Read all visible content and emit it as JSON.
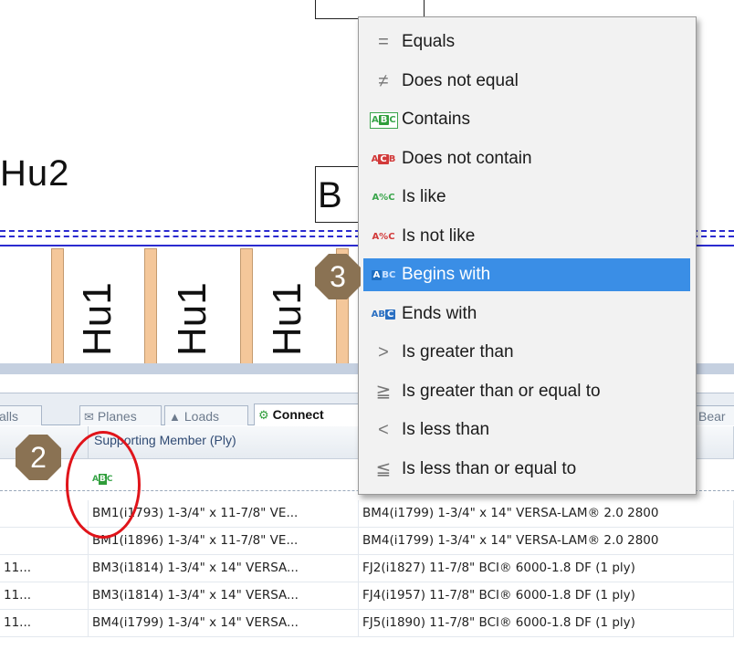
{
  "canvas": {
    "label_left": "Hu2",
    "label_box": "B",
    "joist_labels": [
      "Hu1",
      "Hu1",
      "Hu1"
    ]
  },
  "tabs": [
    {
      "label": "alls",
      "icon": "wall-icon",
      "active": false
    },
    {
      "label": "Planes",
      "icon": "envelope-plane-icon",
      "active": false
    },
    {
      "label": "Loads",
      "icon": "load-icon",
      "active": false
    },
    {
      "label": "Connect",
      "icon": "connection-icon",
      "active": true
    },
    {
      "label": "Bear",
      "icon": "bearing-icon",
      "active": false
    }
  ],
  "grid": {
    "column_header": "Supporting Member (Ply)",
    "filter_icon": "contains-filter-icon",
    "rows": [
      {
        "c0": "",
        "c1": "BM1(i1793) 1-3/4\" x 11-7/8\" VE...",
        "c2": "BM4(i1799) 1-3/4\" x 14\" VERSA-LAM® 2.0 2800"
      },
      {
        "c0": "",
        "c1": "BM1(i1896) 1-3/4\" x 11-7/8\" VE...",
        "c2": "BM4(i1799) 1-3/4\" x 14\" VERSA-LAM® 2.0 2800"
      },
      {
        "c0": "11...",
        "c1": "BM3(i1814) 1-3/4\" x 14\" VERSA...",
        "c2": "FJ2(i1827) 11-7/8\" BCI® 6000-1.8 DF (1 ply)"
      },
      {
        "c0": "11...",
        "c1": "BM3(i1814) 1-3/4\" x 14\" VERSA...",
        "c2": "FJ4(i1957) 11-7/8\" BCI® 6000-1.8 DF (1 ply)"
      },
      {
        "c0": "11...",
        "c1": "BM4(i1799) 1-3/4\" x 14\" VERSA...",
        "c2": "FJ5(i1890) 11-7/8\" BCI® 6000-1.8 DF (1 ply)"
      }
    ]
  },
  "menu": {
    "items": [
      {
        "label": "Equals",
        "icon": "equals-icon",
        "glyph": "="
      },
      {
        "label": "Does not equal",
        "icon": "not-equal-icon",
        "glyph": "≠"
      },
      {
        "label": "Contains",
        "icon": "contains-icon",
        "glyph": "ABC"
      },
      {
        "label": "Does not contain",
        "icon": "does-not-contain-icon",
        "glyph": "ACB"
      },
      {
        "label": "Is like",
        "icon": "is-like-icon",
        "glyph": "A%C"
      },
      {
        "label": "Is not like",
        "icon": "is-not-like-icon",
        "glyph": "A%C"
      },
      {
        "label": "Begins with",
        "icon": "begins-with-icon",
        "glyph": "AB",
        "selected": true
      },
      {
        "label": "Ends with",
        "icon": "ends-with-icon",
        "glyph": "ABC"
      },
      {
        "label": "Is greater than",
        "icon": "greater-than-icon",
        "glyph": ">"
      },
      {
        "label": "Is greater than or equal to",
        "icon": "greater-equal-icon",
        "glyph": "≧"
      },
      {
        "label": "Is less than",
        "icon": "less-than-icon",
        "glyph": "<"
      },
      {
        "label": "Is less than or equal to",
        "icon": "less-equal-icon",
        "glyph": "≦"
      }
    ]
  },
  "annotations": {
    "step2": "2",
    "step3": "3"
  },
  "colors": {
    "selection": "#3a8ee6",
    "marker": "#8a7253",
    "callout": "#e0141a",
    "rail": "#2b2bd0",
    "joist": "#f4c79a"
  }
}
